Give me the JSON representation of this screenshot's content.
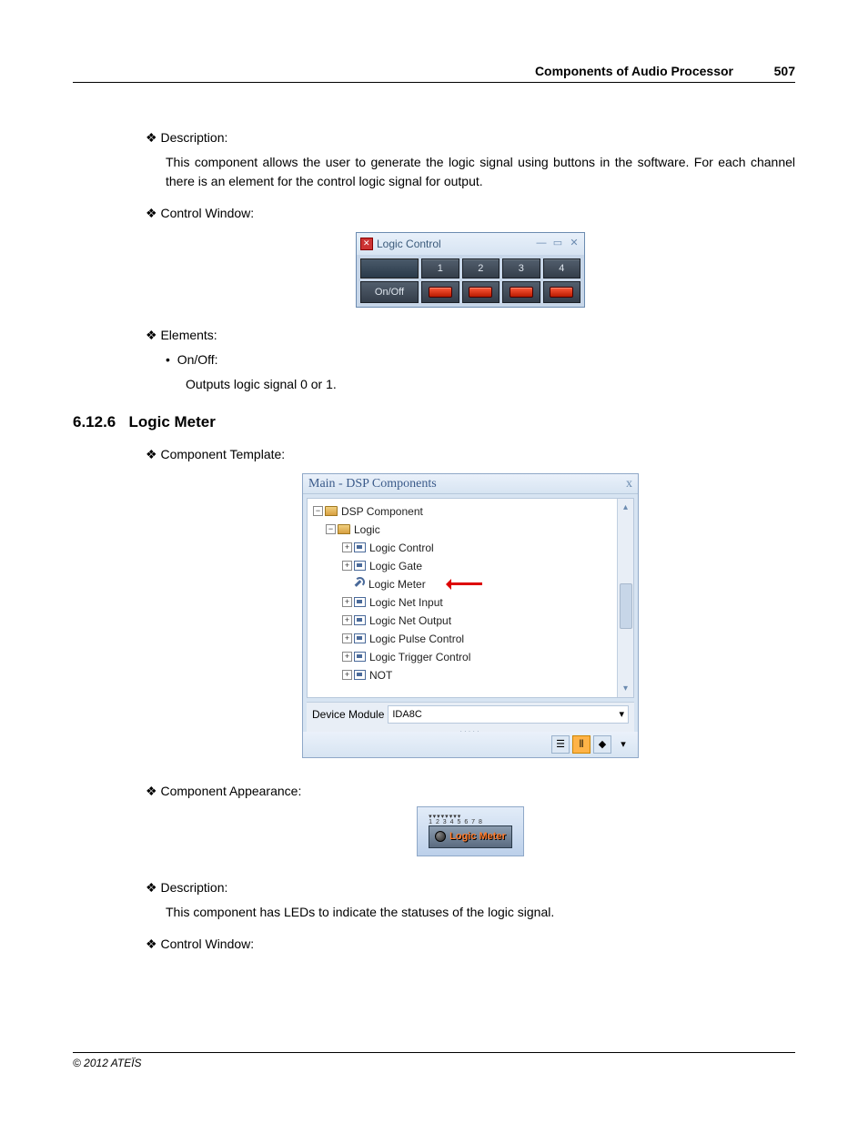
{
  "header": {
    "title": "Components of Audio Processor",
    "page": "507"
  },
  "section": {
    "desc_h": "Description:",
    "desc_body": "This component allows the user to generate the logic signal using buttons in the software. For each channel there is an element for the control logic signal for output.",
    "ctrl_h": "Control Window:",
    "elem_h": "Elements:",
    "onoff_h": "On/Off:",
    "onoff_body": "Outputs logic signal 0 or 1.",
    "sec_num": "6.12.6",
    "sec_title": "Logic Meter",
    "tmpl_h": "Component Template:",
    "appear_h": "Component Appearance:",
    "desc2_h": "Description:",
    "desc2_body": "This component has LEDs to indicate the statuses of the logic signal.",
    "ctrl2_h": "Control Window:"
  },
  "logic_control": {
    "title": "Logic Control",
    "cols": [
      "1",
      "2",
      "3",
      "4"
    ],
    "row_label": "On/Off"
  },
  "dsp": {
    "title": "Main - DSP Components",
    "close": "x",
    "root": "DSP Component",
    "folder": "Logic",
    "items": [
      "Logic Control",
      "Logic Gate",
      "Logic Meter",
      "Logic Net Input",
      "Logic Net Output",
      "Logic Pulse Control",
      "Logic Trigger Control",
      "NOT"
    ],
    "footer_label": "Device Module",
    "footer_value": "IDA8C"
  },
  "logic_meter": {
    "label": "Logic Meter"
  },
  "footer": {
    "copyright": "© 2012 ATEÏS"
  }
}
